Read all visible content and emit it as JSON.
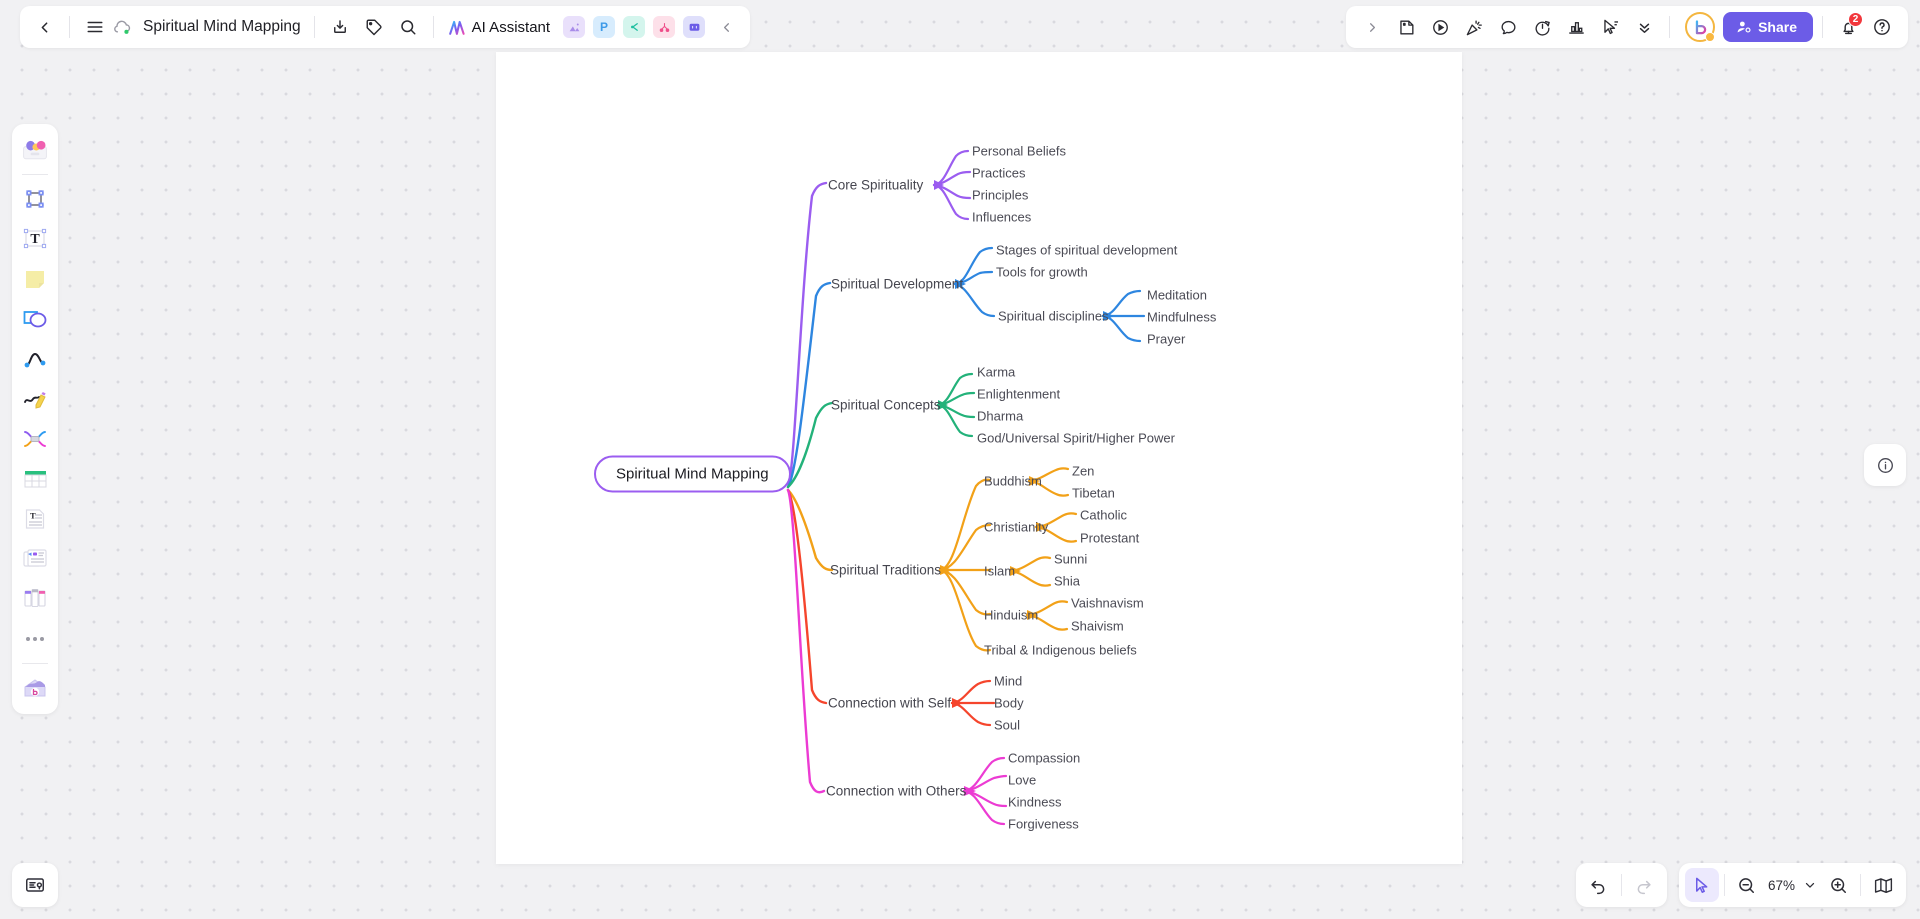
{
  "header": {
    "back_icon": "chevron-left-icon",
    "menu_icon": "hamburger-menu-icon",
    "cloud_icon": "cloud-sync-icon",
    "doc_title": "Spiritual Mind Mapping",
    "download_icon": "download-icon",
    "tag_icon": "tag-icon",
    "search_icon": "search-icon",
    "ai_assistant_label": "AI Assistant",
    "ai_assistant_icon": "ai-sparkle-icon",
    "app_icons": [
      {
        "name": "image-app-icon",
        "glyph": "▲",
        "bg": "#e9e0fb",
        "fg": "#9a7ce8"
      },
      {
        "name": "presentation-app-icon",
        "glyph": "P",
        "bg": "#d7ecfd",
        "fg": "#3d9ae8"
      },
      {
        "name": "mindmap-app-icon",
        "glyph": "⭠",
        "bg": "#d4f5ed",
        "fg": "#1fbfa0"
      },
      {
        "name": "flowchart-app-icon",
        "glyph": "⑂",
        "bg": "#fde0e9",
        "fg": "#ef4f8a"
      },
      {
        "name": "chat-app-icon",
        "glyph": "▭",
        "bg": "#dfdffb",
        "fg": "#6c5ce7"
      }
    ],
    "collapse_icon": "chevron-left-icon"
  },
  "header_right": {
    "expand_icon": "chevron-right-icon",
    "tools": [
      {
        "name": "sticker-icon"
      },
      {
        "name": "play-circle-icon"
      },
      {
        "name": "celebrate-icon"
      },
      {
        "name": "comment-icon"
      },
      {
        "name": "timer-icon"
      },
      {
        "name": "chart-icon"
      },
      {
        "name": "cursor-select-icon"
      },
      {
        "name": "chevron-double-down-icon"
      }
    ],
    "avatar_name": "user-avatar",
    "share_label": "Share",
    "share_icon": "share-user-icon",
    "share_color": "#6c5ce7",
    "bell_icon": "notification-bell-icon",
    "notification_count": "2",
    "help_icon": "help-circle-icon"
  },
  "sidebar": {
    "items": [
      {
        "name": "sidebar-tool-templates",
        "label": "Templates"
      },
      {
        "name": "sidebar-tool-frame",
        "label": "Frame"
      },
      {
        "name": "sidebar-tool-text",
        "label": "Text"
      },
      {
        "name": "sidebar-tool-sticky-note",
        "label": "Sticky Note"
      },
      {
        "name": "sidebar-tool-shapes",
        "label": "Shapes"
      },
      {
        "name": "sidebar-tool-connector",
        "label": "Connector"
      },
      {
        "name": "sidebar-tool-pen",
        "label": "Pen"
      },
      {
        "name": "sidebar-tool-mindmap",
        "label": "Mind Map"
      },
      {
        "name": "sidebar-tool-table",
        "label": "Table"
      },
      {
        "name": "sidebar-tool-document",
        "label": "Document"
      },
      {
        "name": "sidebar-tool-card",
        "label": "Card"
      },
      {
        "name": "sidebar-tool-kanban",
        "label": "Kanban"
      },
      {
        "name": "sidebar-tool-more",
        "label": "More"
      },
      {
        "name": "sidebar-tool-upload",
        "label": "Upload"
      }
    ]
  },
  "footer": {
    "notes_icon": "notes-panel-icon",
    "info_icon": "info-circle-icon",
    "undo_icon": "undo-icon",
    "redo_icon": "redo-icon",
    "select_icon": "cursor-pointer-icon",
    "zoom_out_icon": "zoom-out-icon",
    "zoom_level": "67%",
    "zoom_chevron_icon": "chevron-down-icon",
    "zoom_in_icon": "zoom-in-icon",
    "minimap_icon": "minimap-icon"
  },
  "mindmap": {
    "root": {
      "label": "Spiritual Mind Mapping",
      "color": "#9b5df0"
    },
    "branches": [
      {
        "label": "Core Spirituality",
        "color": "#9b5df0",
        "children": [
          {
            "label": "Personal Beliefs"
          },
          {
            "label": "Practices"
          },
          {
            "label": "Principles"
          },
          {
            "label": "Influences"
          }
        ]
      },
      {
        "label": "Spiritual Development",
        "color": "#2e86e0",
        "children": [
          {
            "label": "Stages of spiritual development"
          },
          {
            "label": "Tools for growth"
          },
          {
            "label": "Spiritual disciplines",
            "children": [
              {
                "label": "Meditation"
              },
              {
                "label": "Mindfulness"
              },
              {
                "label": "Prayer"
              }
            ]
          }
        ]
      },
      {
        "label": "Spiritual Concepts",
        "color": "#23b27a",
        "children": [
          {
            "label": "Karma"
          },
          {
            "label": "Enlightenment"
          },
          {
            "label": "Dharma"
          },
          {
            "label": "God/Universal Spirit/Higher Power"
          }
        ]
      },
      {
        "label": "Spiritual Traditions",
        "color": "#f2a118",
        "children": [
          {
            "label": "Buddhism",
            "children": [
              {
                "label": "Zen"
              },
              {
                "label": "Tibetan"
              }
            ]
          },
          {
            "label": "Christianity",
            "children": [
              {
                "label": "Catholic"
              },
              {
                "label": "Protestant"
              }
            ]
          },
          {
            "label": "Islam",
            "children": [
              {
                "label": "Sunni"
              },
              {
                "label": "Shia"
              }
            ]
          },
          {
            "label": "Hinduism",
            "children": [
              {
                "label": "Vaishnavism"
              },
              {
                "label": "Shaivism"
              }
            ]
          },
          {
            "label": "Tribal & Indigenous beliefs"
          }
        ]
      },
      {
        "label": "Connection with Self",
        "color": "#f5452c",
        "children": [
          {
            "label": "Mind"
          },
          {
            "label": "Body"
          },
          {
            "label": "Soul"
          }
        ]
      },
      {
        "label": "Connection with Others",
        "color": "#ec3bd3",
        "children": [
          {
            "label": "Compassion"
          },
          {
            "label": "Love"
          },
          {
            "label": "Kindness"
          },
          {
            "label": "Forgiveness"
          }
        ]
      }
    ]
  }
}
